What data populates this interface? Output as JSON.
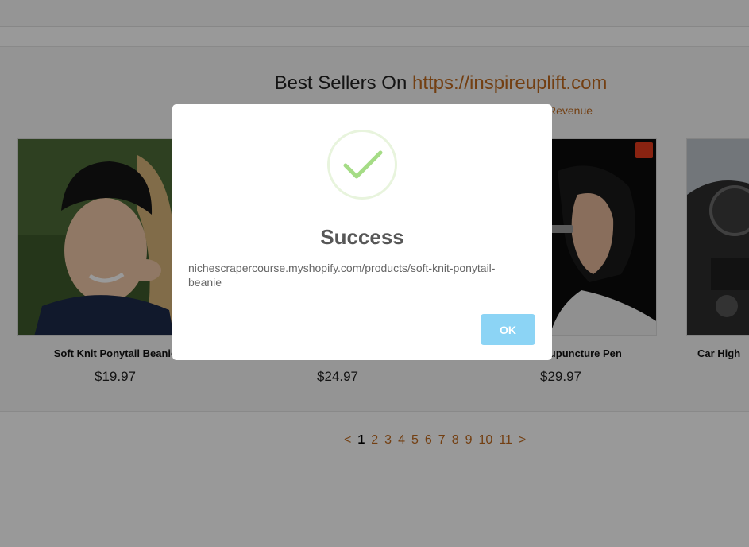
{
  "section": {
    "heading_prefix": "Best Sellers On ",
    "heading_link": "https://inspireuplift.com",
    "subheading": "Revenue"
  },
  "products": [
    {
      "name": "Soft Knit Ponytail Beanie",
      "price": "$19.97"
    },
    {
      "name": "",
      "price": "$24.97"
    },
    {
      "name": "Acupuncture Pen",
      "price": "$29.97"
    },
    {
      "name": "Car High",
      "price": ""
    }
  ],
  "pagination": {
    "prev": "<",
    "pages": [
      "1",
      "2",
      "3",
      "4",
      "5",
      "6",
      "7",
      "8",
      "9",
      "10",
      "11"
    ],
    "current": "1",
    "next": ">"
  },
  "modal": {
    "icon": "check-icon",
    "title": "Success",
    "message": "nichescrapercourse.myshopify.com/products/soft-knit-ponytail-beanie",
    "ok_label": "OK"
  },
  "colors": {
    "link": "#c06a1e",
    "ok_button": "#8cd4f5",
    "check": "#a5dc86"
  }
}
